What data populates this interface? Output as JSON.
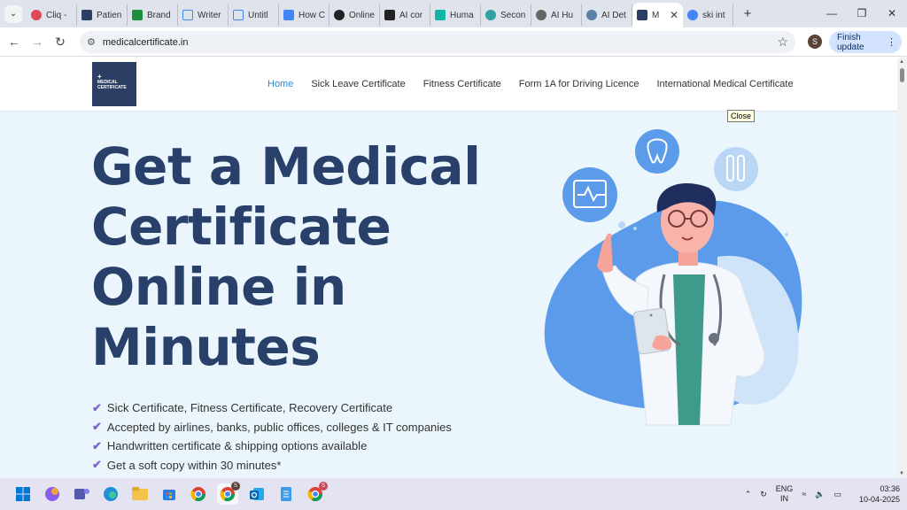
{
  "browser": {
    "tabs": [
      {
        "label": "Cliq -",
        "color": "#e0485a"
      },
      {
        "label": "Patien",
        "color": "#2c3e63"
      },
      {
        "label": "Brand",
        "color": "#1e8e3e"
      },
      {
        "label": "Writer",
        "color": "#4285f4"
      },
      {
        "label": "Untitl",
        "color": "#4285f4"
      },
      {
        "label": "How C",
        "color": "#4285f4"
      },
      {
        "label": "Online",
        "color": "#222222"
      },
      {
        "label": "AI cor",
        "color": "#222222"
      },
      {
        "label": "Huma",
        "color": "#12b5a6"
      },
      {
        "label": "Secon",
        "color": "#34a0a4"
      },
      {
        "label": "AI Hu",
        "color": "#666666"
      },
      {
        "label": "AI Det",
        "color": "#5b7fa6"
      },
      {
        "label": "M",
        "color": "#2c3e63"
      },
      {
        "label": "ski int",
        "color": "#4285f4"
      }
    ],
    "url": "medicalcertificate.in",
    "profile_initial": "S",
    "finish_update": "Finish update"
  },
  "site": {
    "logo_line1": "MEDICAL",
    "logo_line2": "CERTIFICATE",
    "nav": [
      "Home",
      "Sick Leave Certificate",
      "Fitness Certificate",
      "Form 1A for Driving Licence",
      "International Medical Certificate"
    ],
    "tooltip": "Close",
    "headline": "Get a Medical Certificate Online in Minutes",
    "features": [
      "Sick Certificate, Fitness Certificate, Recovery Certificate",
      "Accepted by airlines, banks, public offices, colleges & IT companies",
      "Handwritten certificate & shipping options available",
      "Get a soft copy within 30 minutes*"
    ]
  },
  "taskbar": {
    "lang_line1": "ENG",
    "lang_line2": "IN",
    "time": "03:36",
    "date": "10-04-2025",
    "badge1": "S",
    "badge2": "S"
  }
}
